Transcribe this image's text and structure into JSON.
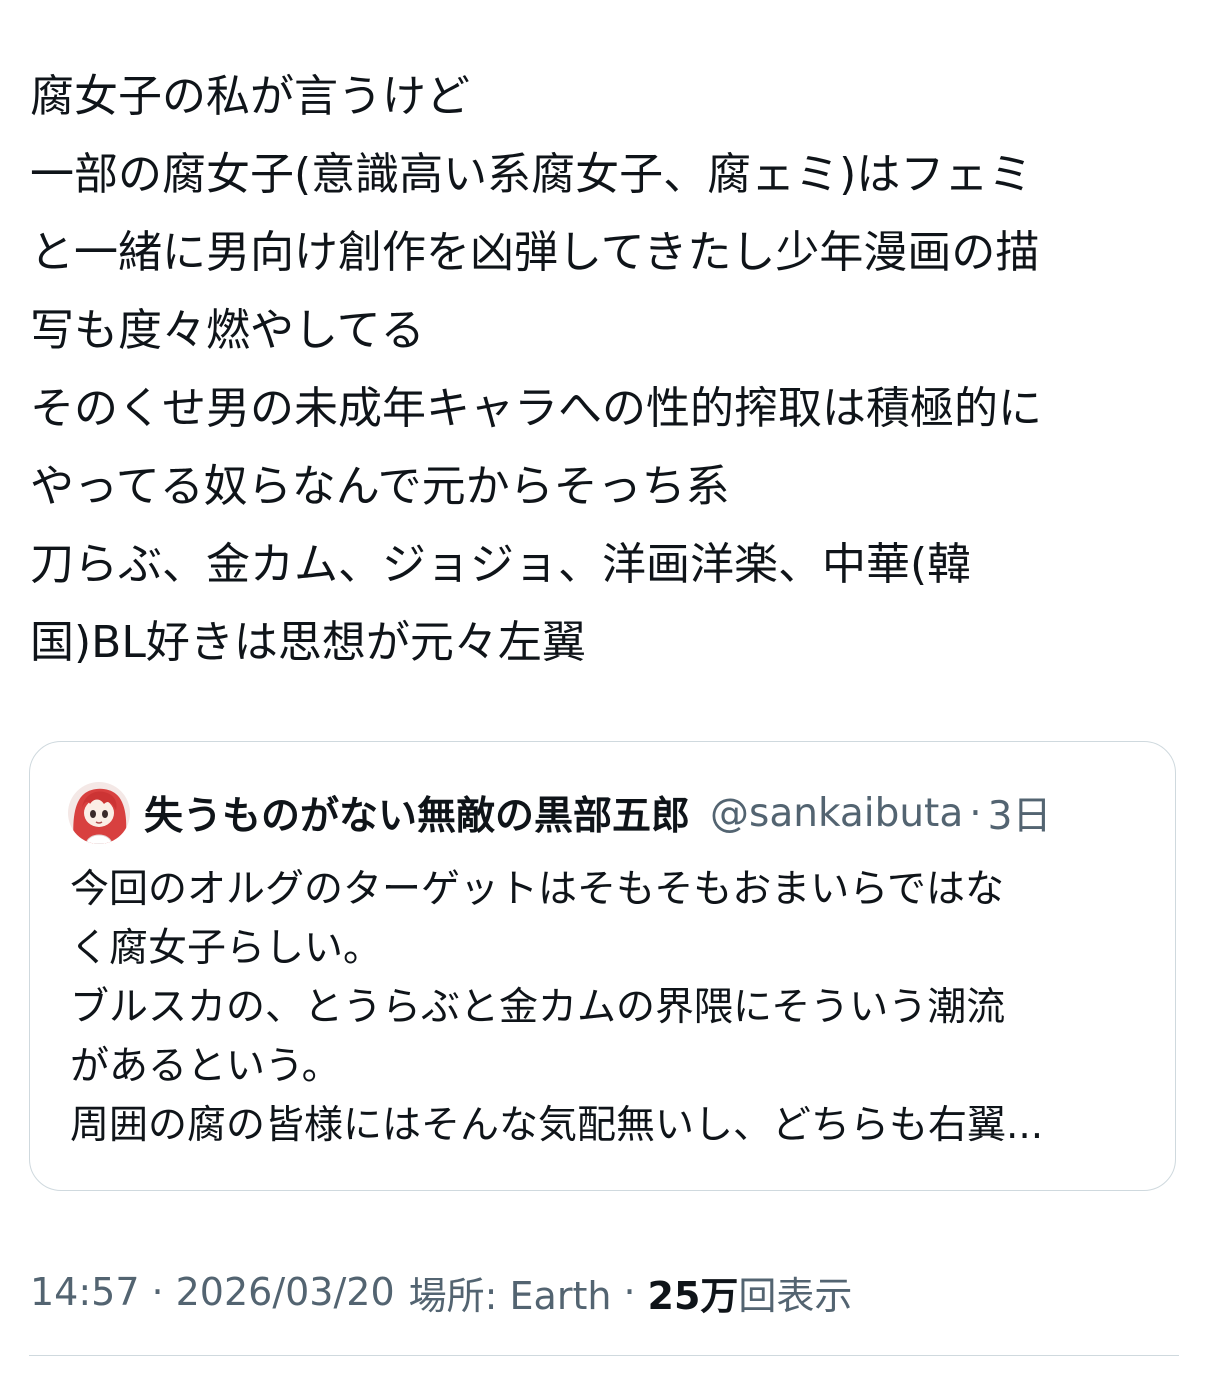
{
  "tweet": {
    "lines": [
      "腐女子の私が言うけど",
      "一部の腐女子(意識高い系腐女子、腐ェミ)はフェミ",
      "と一緒に男向け創作を凶弾してきたし少年漫画の描",
      "写も度々燃やしてる",
      "そのくせ男の未成年キャラへの性的搾取は積極的に",
      "やってる奴らなんで元からそっち系",
      "刀らぶ、金カム、ジョジョ、洋画洋楽、中華(韓",
      "国)BL好きは思想が元々左翼"
    ]
  },
  "quote": {
    "name": "失うものがない無敵の黒部五郎",
    "handle": "@sankaibuta",
    "dot": "·",
    "time": "3日",
    "lines": [
      "今回のオルグのターゲットはそもそもおまいらではな",
      "く腐女子らしい。",
      "ブルスカの、とうらぶと金カムの界隈にそういう潮流",
      "があるという。",
      "周囲の腐の皆様にはそんな気配無いし、どちらも右翼..."
    ],
    "avatar_icon": "avatar-anime-girl-icon"
  },
  "meta": {
    "time": "14:57",
    "sep": "·",
    "date": "2026/03/20",
    "location": "場所: Earth",
    "views_count": "25万",
    "views_label": "回表示"
  },
  "colors": {
    "text": "#0f1419",
    "secondary": "#536471",
    "border": "#cfd9de"
  }
}
